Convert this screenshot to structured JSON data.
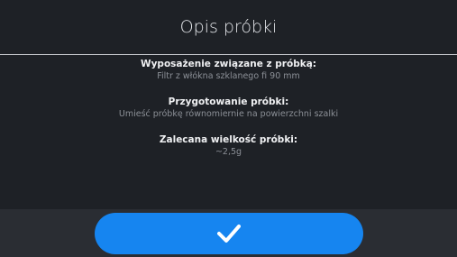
{
  "dialog": {
    "title": "Opis próbki",
    "sections": [
      {
        "label": "Wyposażenie związane z próbką:",
        "value": "Filtr z włókna szklanego fi 90 mm"
      },
      {
        "label": "Przygotowanie próbki:",
        "value": "Umieść próbkę równomiernie na powierzchni szalki"
      },
      {
        "label": "Zalecana wielkość próbki:",
        "value": "~2,5g"
      }
    ]
  },
  "footer": {
    "ok_button_icon": "checkmark-icon"
  },
  "colors": {
    "background": "#1e2126",
    "accent": "#1685f0",
    "footer": "#2a2d33"
  }
}
